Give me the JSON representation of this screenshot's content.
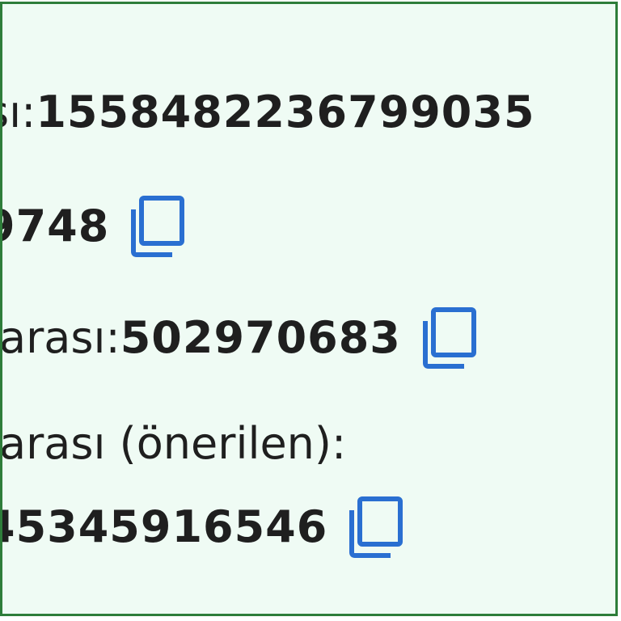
{
  "lines": {
    "l1": {
      "label": "sı: ",
      "value": "1558482236799035"
    },
    "l2": {
      "value": "9748"
    },
    "l3": {
      "label": "arası: ",
      "value": "502970683"
    },
    "l4": {
      "label": "arası (önerilen):"
    },
    "l5": {
      "value": "45345916546"
    }
  },
  "colors": {
    "border": "#2e7d3a",
    "background": "#effbf4",
    "text": "#1f1f1f",
    "icon": "#2a6fd1"
  },
  "icons": {
    "copy": "copy-icon"
  }
}
